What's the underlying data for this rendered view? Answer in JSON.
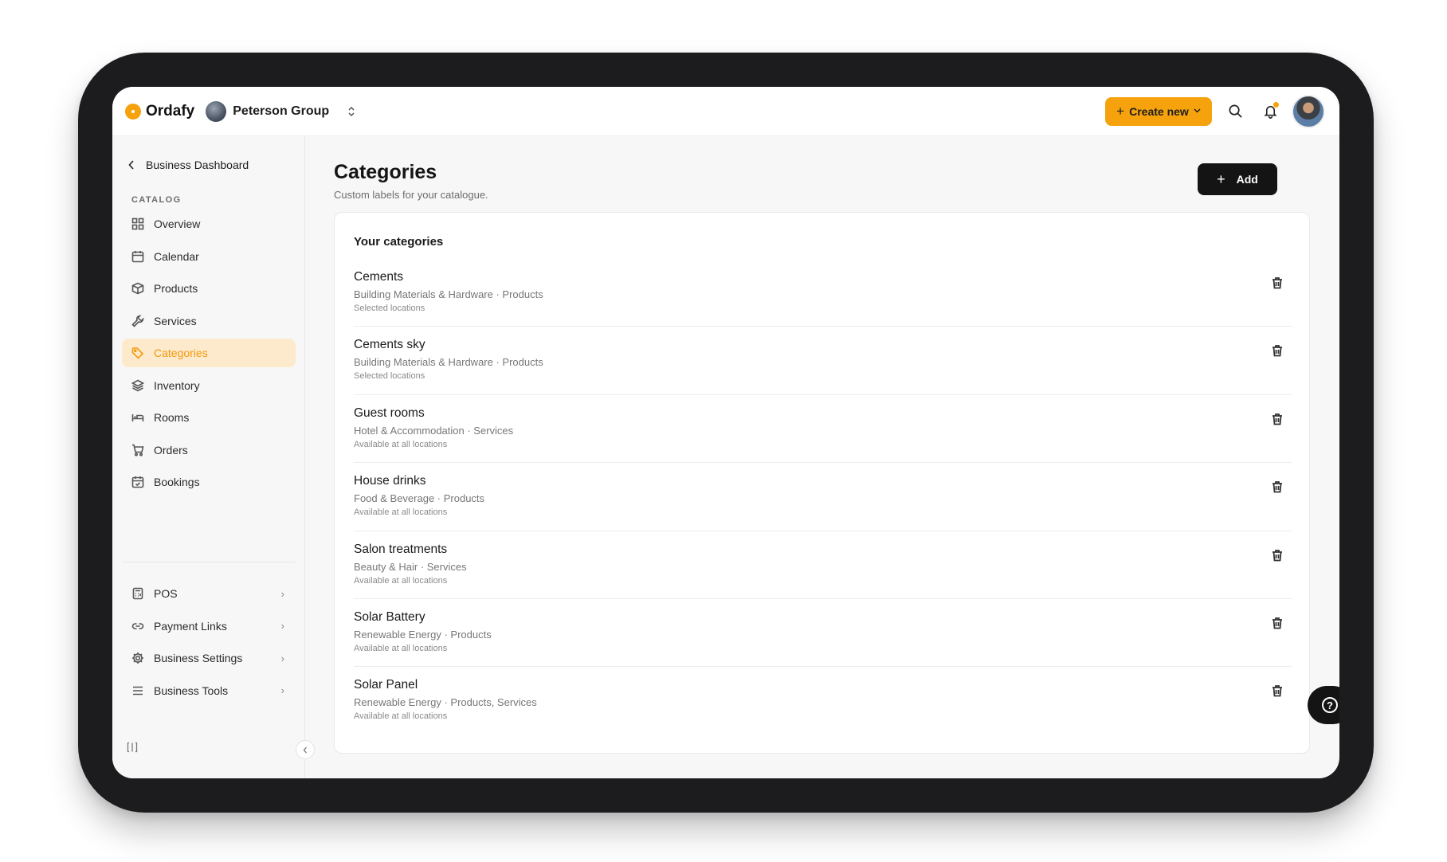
{
  "app": {
    "name": "Ordafy",
    "org_name": "Peterson Group",
    "accent_color": "#f5a20d"
  },
  "topbar": {
    "create_label": "Create new",
    "icons": [
      "search-icon",
      "bell-icon",
      "avatar"
    ]
  },
  "sidebar": {
    "back_label": "Business Dashboard",
    "section_label": "CATALOG",
    "items": [
      {
        "label": "Overview",
        "icon": "grid-icon"
      },
      {
        "label": "Calendar",
        "icon": "calendar-icon"
      },
      {
        "label": "Products",
        "icon": "box-icon"
      },
      {
        "label": "Services",
        "icon": "wrench-icon"
      },
      {
        "label": "Categories",
        "icon": "tag-icon",
        "active": true
      },
      {
        "label": "Inventory",
        "icon": "layers-icon"
      },
      {
        "label": "Rooms",
        "icon": "bed-icon"
      },
      {
        "label": "Orders",
        "icon": "cart-icon"
      },
      {
        "label": "Bookings",
        "icon": "calendar-check-icon"
      }
    ],
    "secondary_items": [
      {
        "label": "POS",
        "icon": "pos-icon"
      },
      {
        "label": "Payment Links",
        "icon": "link-icon"
      },
      {
        "label": "Business Settings",
        "icon": "gear-icon"
      },
      {
        "label": "Business Tools",
        "icon": "menu-icon"
      }
    ]
  },
  "main": {
    "title": "Categories",
    "subtitle": "Custom labels for your catalogue.",
    "add_label": "Add",
    "card_title": "Your categories",
    "categories": [
      {
        "name": "Cements",
        "meta": "Building Materials & Hardware · Products",
        "location": "Selected locations"
      },
      {
        "name": "Cements sky",
        "meta": "Building Materials & Hardware · Products",
        "location": "Selected locations"
      },
      {
        "name": "Guest rooms",
        "meta": "Hotel & Accommodation · Services",
        "location": "Available at all locations"
      },
      {
        "name": "House drinks",
        "meta": "Food & Beverage · Products",
        "location": "Available at all locations"
      },
      {
        "name": "Salon treatments",
        "meta": "Beauty & Hair · Services",
        "location": "Available at all locations"
      },
      {
        "name": "Solar Battery",
        "meta": "Renewable Energy · Products",
        "location": "Available at all locations"
      },
      {
        "name": "Solar Panel",
        "meta": "Renewable Energy · Products, Services",
        "location": "Available at all locations"
      }
    ]
  }
}
